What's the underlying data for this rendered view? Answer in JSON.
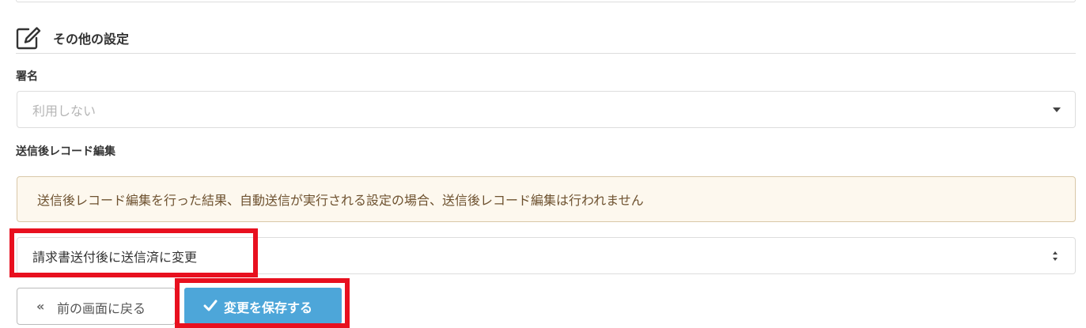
{
  "section": {
    "title": "その他の設定",
    "icon": "edit-icon"
  },
  "signature": {
    "label": "署名",
    "placeholder": "利用しない"
  },
  "post_send_edit": {
    "label": "送信後レコード編集",
    "notice": "送信後レコード編集を行った結果、自動送信が実行される設定の場合、送信後レコード編集は行われません",
    "selected_value": "請求書送付後に送信済に変更"
  },
  "buttons": {
    "back_label": "前の画面に戻る",
    "back_icon": "double-chevron-left-icon",
    "save_label": "変更を保存する",
    "save_icon": "checkmark-icon"
  },
  "colors": {
    "primary": "#4da6d9",
    "highlight": "#e8101f",
    "notice_bg": "#fdf8ee",
    "notice_text": "#6e5230"
  }
}
